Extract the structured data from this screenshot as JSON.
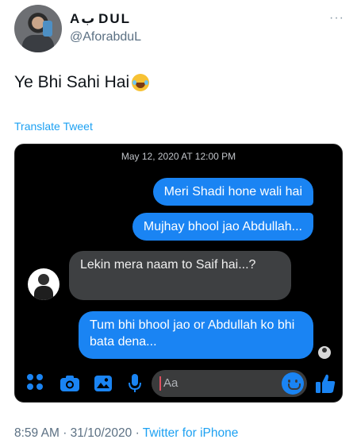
{
  "author": {
    "display_name": "Aب DUL",
    "handle": "@AforabduL"
  },
  "tweet": {
    "text": "Ye Bhi Sahi Hai",
    "emoji": "face-with-tears-of-joy-icon",
    "translate_label": "Translate Tweet",
    "time": "8:59 AM",
    "separator": "·",
    "date": "31/10/2020",
    "source": "Twitter for iPhone"
  },
  "media": {
    "chat_date": "May 12, 2020 AT 12:00 PM",
    "messages": [
      {
        "from": "me",
        "text": "Meri Shadi hone wali hai"
      },
      {
        "from": "me",
        "text": "Mujhay bhool jao Abdullah..."
      },
      {
        "from": "friend",
        "text": "Lekin mera naam to Saif hai...?"
      },
      {
        "from": "me",
        "text": "Tum bhi bhool jao or Abdullah ko bhi bata dena..."
      }
    ],
    "composer": {
      "placeholder": "Aa",
      "icons": [
        "apps-icon",
        "camera-icon",
        "gallery-icon",
        "microphone-icon",
        "emoji-icon",
        "thumbs-up-icon"
      ]
    }
  },
  "colors": {
    "twitter_blue": "#1da1f2",
    "messenger_blue": "#1a84f3",
    "incoming_bubble": "#3e4042",
    "muted_text": "#5b7083"
  }
}
